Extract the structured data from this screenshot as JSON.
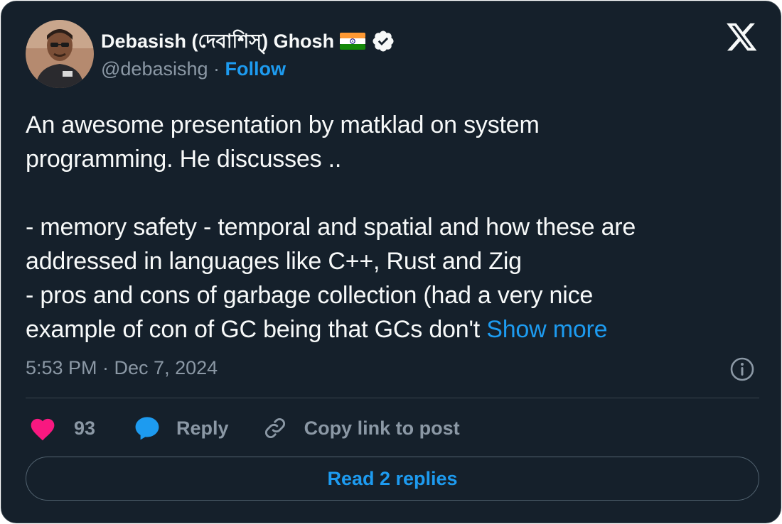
{
  "author": {
    "name": "Debasish (দেবাশিস্) Ghosh",
    "handle": "@debasishg",
    "separator": "·",
    "follow_label": "Follow"
  },
  "icons": {
    "avatar": "profile-photo",
    "flag": "india-flag-icon",
    "verified": "verified-badge-icon",
    "logo": "x-logo-icon",
    "info": "info-icon",
    "like": "heart-icon",
    "reply": "speech-bubble-icon",
    "copy": "link-icon"
  },
  "tweet": {
    "lines": [
      "An awesome presentation by matklad on system",
      "programming. He discusses ..",
      "",
      "- memory safety - temporal and spatial and how these are",
      "addressed in languages like C++, Rust and Zig",
      "- pros and cons of garbage collection (had a very nice"
    ],
    "last_line": "example of con of GC being that GCs don't ",
    "show_more_label": "Show more",
    "timestamp": "5:53 PM · Dec 7, 2024"
  },
  "actions": {
    "like_count": "93",
    "reply_label": "Reply",
    "copy_label": "Copy link to post"
  },
  "read_replies_label": "Read 2 replies",
  "colors": {
    "background": "#15202b",
    "border": "#38444d",
    "text": "#f7f9f9",
    "muted": "#8b98a5",
    "accent": "#1d9bf0",
    "like": "#f91880"
  }
}
